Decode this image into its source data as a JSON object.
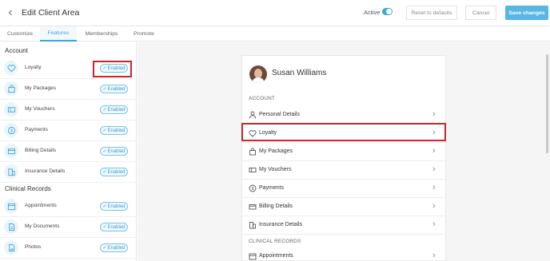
{
  "header": {
    "back_icon": "chevron-left-icon",
    "title": "Edit Client Area",
    "active_label": "Active",
    "active_on": true,
    "reset_label": "Reset to defaults",
    "cancel_label": "Cancel",
    "save_label": "Save changes"
  },
  "tabs": [
    {
      "label": "Customize"
    },
    {
      "label": "Features",
      "active": true
    },
    {
      "label": "Memberships"
    },
    {
      "label": "Promote"
    }
  ],
  "left": {
    "account_title": "Account",
    "account_items": [
      {
        "label": "Loyalty",
        "icon": "heart-icon",
        "status": "Enabled"
      },
      {
        "label": "My Packages",
        "icon": "bag-icon",
        "status": "Enabled"
      },
      {
        "label": "My Vouchers",
        "icon": "voucher-icon",
        "status": "Enabled"
      },
      {
        "label": "Payments",
        "icon": "dollar-icon",
        "status": "Enabled"
      },
      {
        "label": "Billing Details",
        "icon": "card-icon",
        "status": "Enabled"
      },
      {
        "label": "Insurance Details",
        "icon": "building-icon",
        "status": "Enabled"
      }
    ],
    "clinical_title": "Clinical Records",
    "clinical_items": [
      {
        "label": "Appointments",
        "icon": "calendar-icon",
        "status": "Enabled"
      },
      {
        "label": "My Documents",
        "icon": "document-icon",
        "status": "Enabled"
      },
      {
        "label": "Photos",
        "icon": "photo-icon",
        "status": "Enabled"
      }
    ]
  },
  "preview": {
    "user_name": "Susan Williams",
    "account_section": "ACCOUNT",
    "items": [
      {
        "label": "Personal Details",
        "icon": "person-icon"
      },
      {
        "label": "Loyalty",
        "icon": "heart-icon"
      },
      {
        "label": "My Packages",
        "icon": "bag-icon"
      },
      {
        "label": "My Vouchers",
        "icon": "voucher-icon"
      },
      {
        "label": "Payments",
        "icon": "dollar-icon"
      },
      {
        "label": "Billing Details",
        "icon": "card-icon"
      },
      {
        "label": "Insurance Details",
        "icon": "building-icon"
      }
    ],
    "clinical_section": "CLINICAL RECORDS",
    "clinical_items": [
      {
        "label": "Appointments",
        "icon": "calendar-icon"
      }
    ]
  },
  "colors": {
    "accent": "#3ba7d8",
    "highlight": "#c8262e"
  }
}
